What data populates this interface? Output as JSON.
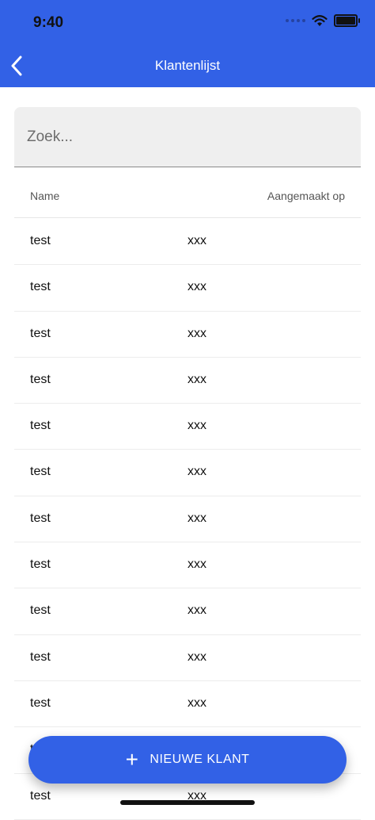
{
  "status_bar": {
    "time": "9:40"
  },
  "header": {
    "title": "Klantenlijst",
    "back_icon": "chevron-left-icon"
  },
  "search": {
    "placeholder": "Zoek...",
    "value": ""
  },
  "table": {
    "columns": [
      "Name",
      "Aangemaakt op"
    ],
    "rows": [
      {
        "name": "test",
        "created": "xxx"
      },
      {
        "name": "test",
        "created": "xxx"
      },
      {
        "name": "test",
        "created": "xxx"
      },
      {
        "name": "test",
        "created": "xxx"
      },
      {
        "name": "test",
        "created": "xxx"
      },
      {
        "name": "test",
        "created": "xxx"
      },
      {
        "name": "test",
        "created": "xxx"
      },
      {
        "name": "test",
        "created": "xxx"
      },
      {
        "name": "test",
        "created": "xxx"
      },
      {
        "name": "test",
        "created": "xxx"
      },
      {
        "name": "test",
        "created": "xxx"
      },
      {
        "name": "test",
        "created": "xxx"
      },
      {
        "name": "test",
        "created": "xxx"
      }
    ]
  },
  "fab": {
    "label": "NIEUWE KLANT",
    "icon": "plus-icon"
  },
  "colors": {
    "primary": "#3261E6",
    "search_bg": "#EFEFEF"
  }
}
